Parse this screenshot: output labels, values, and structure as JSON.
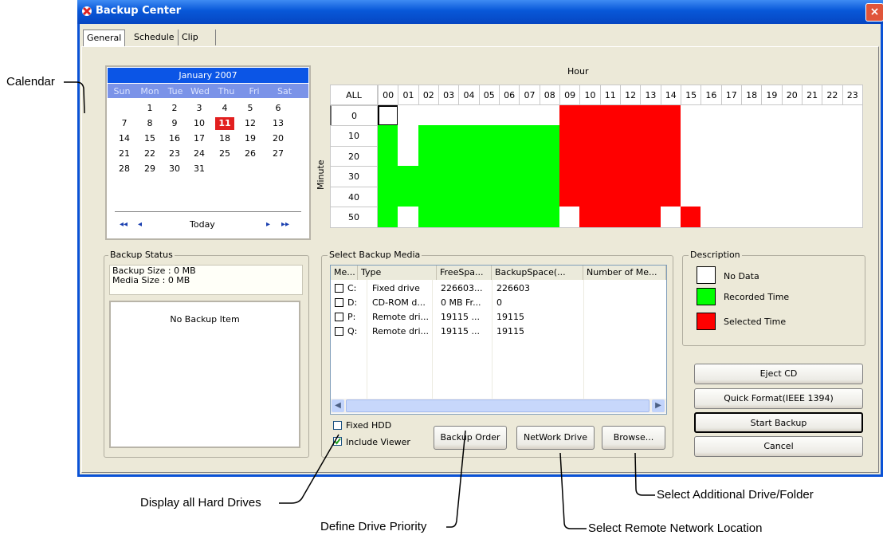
{
  "window": {
    "title": "Backup Center",
    "close_label": "×"
  },
  "tabs": [
    {
      "label": "General"
    },
    {
      "label": "Schedule"
    },
    {
      "label": "Clip"
    }
  ],
  "calendar": {
    "month_year": "January 2007",
    "days_of_week": [
      "Sun",
      "Mon",
      "Tue",
      "Wed",
      "Thu",
      "Fri",
      "Sat"
    ],
    "weeks": [
      [
        "",
        "1",
        "2",
        "3",
        "4",
        "5",
        "6"
      ],
      [
        "7",
        "8",
        "9",
        "10",
        "11",
        "12",
        "13"
      ],
      [
        "14",
        "15",
        "16",
        "17",
        "18",
        "19",
        "20"
      ],
      [
        "21",
        "22",
        "23",
        "24",
        "25",
        "26",
        "27"
      ],
      [
        "28",
        "29",
        "30",
        "31",
        "",
        "",
        ""
      ]
    ],
    "selected_day": "11",
    "today_label": "Today",
    "nav": {
      "first": "◂◂",
      "prev": "◂",
      "next": "▸",
      "last": "▸▸"
    }
  },
  "grid": {
    "hour_label": "Hour",
    "minute_label": "Minute",
    "all_label": "ALL",
    "hours": [
      "00",
      "01",
      "02",
      "03",
      "04",
      "05",
      "06",
      "07",
      "08",
      "09",
      "10",
      "11",
      "12",
      "13",
      "14",
      "15",
      "16",
      "17",
      "18",
      "19",
      "20",
      "21",
      "22",
      "23"
    ],
    "minutes": [
      "0",
      "10",
      "20",
      "30",
      "40",
      "50"
    ],
    "colors": {
      "none": "#ffffff",
      "recorded": "#00ff00",
      "selected": "#ff0000"
    },
    "rows": [
      "NNNNNNNNNSSSSSSNNNNNNNNN",
      "RNRRRRRRRSSSSSSNNNNNNNNN",
      "RNRRRRRRRSSSSSSNNNNNNNNN",
      "RRRRRRRRRSSSSSSNNNNNNNNN",
      "RRRRRRRRRSSSSSSNNNNNNNNN",
      "RNRRRRRRRNSSSSNSNNNNNNNN"
    ]
  },
  "backup_status": {
    "label": "Backup Status",
    "backup_size": "Backup Size : 0 MB",
    "media_size": "Media Size : 0 MB",
    "empty_text": "No Backup Item"
  },
  "media": {
    "label": "Select Backup Media",
    "columns": [
      "Me...",
      "Type",
      "FreeSpa...",
      "BackupSpace(...",
      "Number of Me..."
    ],
    "rows": [
      {
        "drive": "C:",
        "type": "Fixed drive",
        "free": "226603...",
        "backup": "226603",
        "number": ""
      },
      {
        "drive": "D:",
        "type": "CD-ROM d...",
        "free": "0 MB Fr...",
        "backup": "0",
        "number": ""
      },
      {
        "drive": "P:",
        "type": "Remote dri...",
        "free": "19115 ...",
        "backup": "19115",
        "number": ""
      },
      {
        "drive": "Q:",
        "type": "Remote dri...",
        "free": "19115 ...",
        "backup": "19115",
        "number": ""
      }
    ]
  },
  "options": {
    "fixed_hdd": {
      "label": "Fixed HDD",
      "checked": false
    },
    "include_viewer": {
      "label": "Include Viewer",
      "checked": true
    }
  },
  "buttons": {
    "backup_order": "Backup Order",
    "network_drive": "NetWork Drive",
    "browse": "Browse...",
    "eject_cd": "Eject CD",
    "quick_format": "Quick Format(IEEE 1394)",
    "start_backup": "Start Backup",
    "cancel": "Cancel"
  },
  "description": {
    "label": "Description",
    "items": [
      {
        "label": "No Data",
        "color": "#ffffff"
      },
      {
        "label": "Recorded Time",
        "color": "#00ff00"
      },
      {
        "label": "Selected Time",
        "color": "#ff0000"
      }
    ]
  },
  "annotations": {
    "calendar": "Calendar",
    "display_all": "Display all Hard Drives",
    "define_priority": "Define Drive Priority",
    "remote_location": "Select Remote Network Location",
    "additional": "Select Additional Drive/Folder"
  }
}
